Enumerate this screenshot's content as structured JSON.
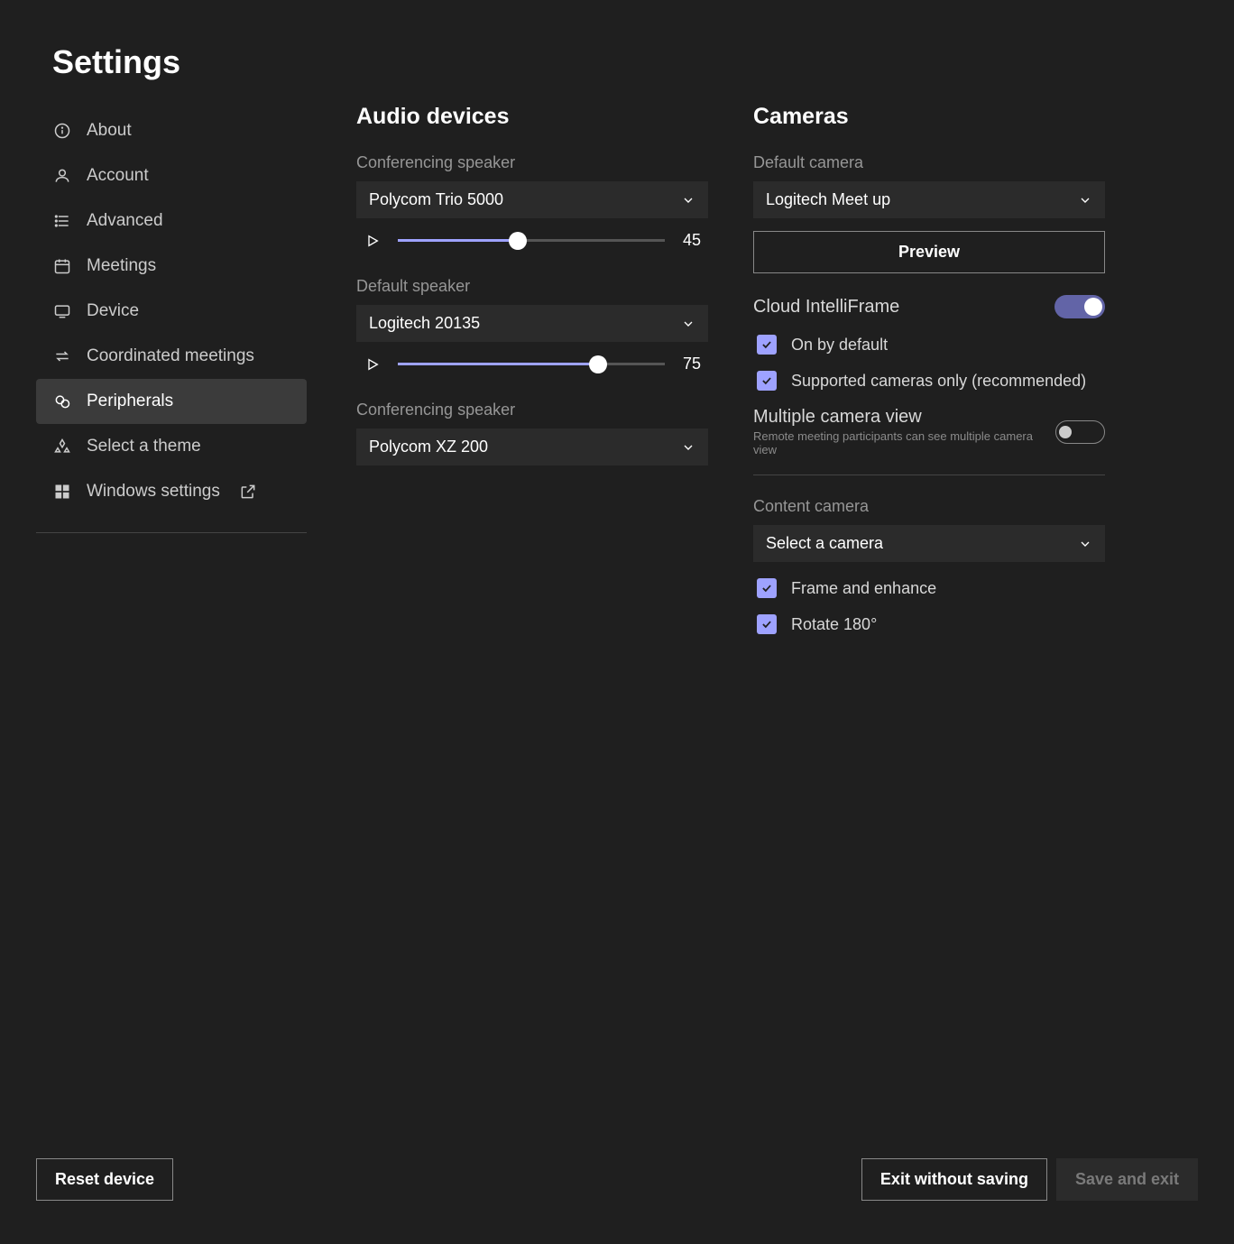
{
  "pageTitle": "Settings",
  "sidebar": {
    "items": [
      {
        "label": "About"
      },
      {
        "label": "Account"
      },
      {
        "label": "Advanced"
      },
      {
        "label": "Meetings"
      },
      {
        "label": "Device"
      },
      {
        "label": "Coordinated meetings"
      },
      {
        "label": "Peripherals"
      },
      {
        "label": "Select a theme"
      },
      {
        "label": "Windows settings"
      }
    ]
  },
  "audio": {
    "title": "Audio devices",
    "confSpeakerLabel": "Conferencing speaker",
    "confSpeakerValue": "Polycom Trio 5000",
    "confSpeakerVol": "45",
    "defaultSpeakerLabel": "Default speaker",
    "defaultSpeakerValue": "Logitech 20135",
    "defaultSpeakerVol": "75",
    "confSpeaker2Label": "Conferencing speaker",
    "confSpeaker2Value": "Polycom XZ 200"
  },
  "cameras": {
    "title": "Cameras",
    "defaultCameraLabel": "Default camera",
    "defaultCameraValue": "Logitech Meet up",
    "previewLabel": "Preview",
    "intelliFrameLabel": "Cloud IntelliFrame",
    "onByDefaultLabel": "On by default",
    "supportedOnlyLabel": "Supported cameras only (recommended)",
    "multiViewLabel": "Multiple camera view",
    "multiViewSub": "Remote meeting participants can see multiple camera view",
    "contentCameraLabel": "Content camera",
    "contentCameraValue": "Select a camera",
    "frameEnhanceLabel": "Frame and enhance",
    "rotateLabel": "Rotate 180°"
  },
  "footer": {
    "reset": "Reset device",
    "exitNoSave": "Exit without saving",
    "saveExit": "Save and exit"
  }
}
